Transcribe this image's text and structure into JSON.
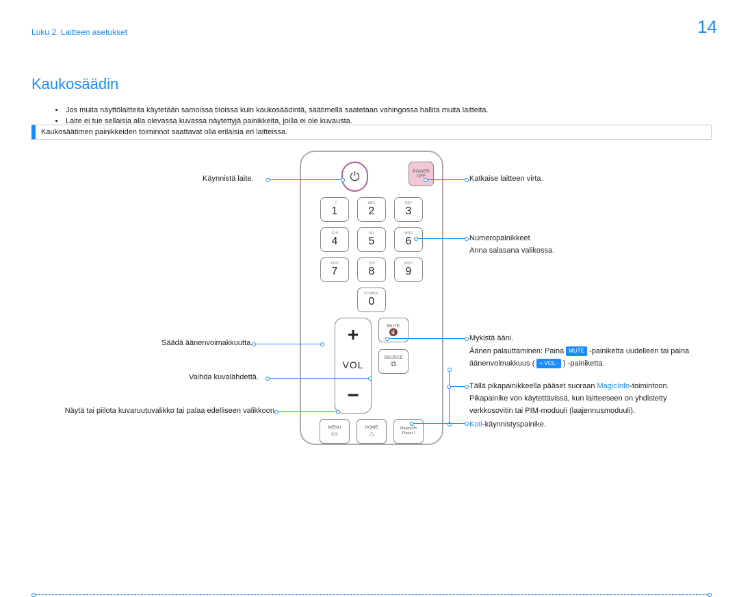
{
  "header": {
    "chapter": "Luku 2. Laitteen asetukset",
    "pageNumber": "14"
  },
  "title": "Kaukosäädin",
  "bullets": [
    "Jos muita näyttölaitteita käytetään samoissa tiloissa kuin kaukosäädintä, säätimellä saatetaan vahingossa hallita muita laitteita.",
    "Laite ei tue sellaisia alla olevassa kuvassa näytettyjä painikkeita, joilla ei ole kuvausta."
  ],
  "note": "Kaukosäätimen painikkeiden toiminnot saattavat olla erilaisia eri laitteissa.",
  "remote": {
    "power_off_l1": "POWER",
    "power_off_l2": "OFF",
    "keys": [
      {
        "sub": ".,?",
        "d": "1"
      },
      {
        "sub": "ABC",
        "d": "2"
      },
      {
        "sub": "DEF",
        "d": "3"
      },
      {
        "sub": "GHI",
        "d": "4"
      },
      {
        "sub": "JKL",
        "d": "5"
      },
      {
        "sub": "MNO",
        "d": "6"
      },
      {
        "sub": "PRS",
        "d": "7"
      },
      {
        "sub": "TUV",
        "d": "8"
      },
      {
        "sub": "WXY",
        "d": "9"
      },
      {
        "sub": "SYMBOL",
        "d": "0"
      }
    ],
    "vol_plus": "+",
    "vol_label": "VOL",
    "vol_minus": "−",
    "mute": "MUTE",
    "mute_glyph": "🔇",
    "source": "SOURCE",
    "source_glyph": "⧉",
    "menu": "MENU",
    "menu_glyph": "▭",
    "home": "HOME",
    "home_glyph": "⌂",
    "magic_l1": "MagicInfo",
    "magic_l2": "Player I"
  },
  "callouts": {
    "power_on": "Käynnistä laite.",
    "vol": "Säädä äänenvoimakkuutta.",
    "source": "Vaihda kuvalähdettä.",
    "menu": "Näytä tai piilota kuvaruutuvalikko tai palaa edelliseen valikkoon.",
    "power_off": "Katkaise laitteen virta.",
    "num_l1": "Numeropainikkeet",
    "num_l2": "Anna salasana valikossa.",
    "mute_l1": "Mykistä ääni.",
    "mute_l2a": "Äänen palauttaminen: Paina ",
    "mute_tag": "MUTE",
    "mute_l2b": "-painiketta uudelleen tai paina",
    "mute_l3a": "äänenvoimakkuus (",
    "mute_tag2": "+ VOL -",
    "mute_l3b": ") -painiketta.",
    "magic_a": "Tällä pikapainikkeella pääset suoraan ",
    "magic_hi": "MagicInfo",
    "magic_b": "-toimintoon.",
    "magic_c": "Pikapainike von käytettävissä, kun laitteeseen on yhdistetty",
    "magic_d": "verkkosovitin tai PIM-moduuli (laajennusmoduuli).",
    "home_a": "Koti",
    "home_b": "-käynnistyspainike."
  }
}
